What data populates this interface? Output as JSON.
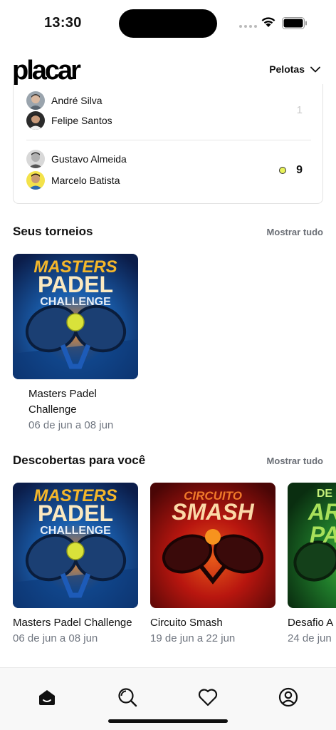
{
  "status_bar": {
    "time": "13:30"
  },
  "header": {
    "logo": "placar",
    "sport_selector": "Pelotas"
  },
  "match_card": {
    "team_a": {
      "players": [
        "André Silva",
        "Felipe Santos"
      ],
      "score": "1"
    },
    "team_b": {
      "players": [
        "Gustavo Almeida",
        "Marcelo Batista"
      ],
      "score": "9",
      "serving_indicator": "tennis-ball-dot"
    }
  },
  "my_tournaments": {
    "title": "Seus torneios",
    "show_all": "Mostrar tudo",
    "items": [
      {
        "poster": {
          "line1": "MASTERS",
          "line2": "PADEL",
          "line3": "CHALLENGE"
        },
        "name": "Masters Padel Challenge",
        "dates": "06 de jun a 08 jun"
      }
    ]
  },
  "discover": {
    "title": "Descobertas para você",
    "show_all": "Mostrar tudo",
    "items": [
      {
        "poster": {
          "line1": "MASTERS",
          "line2": "PADEL",
          "line3": "CHALLENGE"
        },
        "name": "Masters Padel Challenge",
        "dates": "06 de jun a 08 jun"
      },
      {
        "poster": {
          "line1": "CIRCUITO",
          "line2": "SMASH"
        },
        "name": "Circuito Smash",
        "dates": "19 de jun a 22 jun"
      },
      {
        "poster": {
          "line1": "DE",
          "line2": "AR",
          "line3": "PA"
        },
        "name": "Desafio A",
        "dates": "24 de jun"
      }
    ]
  },
  "tab_bar": {
    "tabs": [
      "home-icon",
      "search-icon",
      "heart-icon",
      "profile-icon"
    ]
  },
  "colors": {
    "accent_ball": "#e8f25a",
    "muted_text": "#707680",
    "poster_gold": "#f5b72a",
    "poster_red": "#b8160f"
  }
}
